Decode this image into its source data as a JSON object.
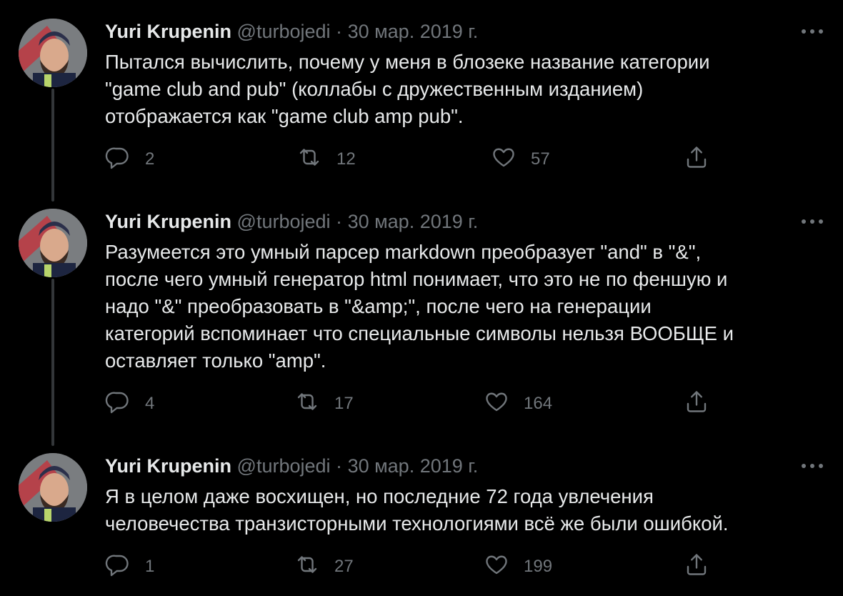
{
  "tweets": [
    {
      "name": "Yuri Krupenin",
      "handle": "@turbojedi",
      "separator": "·",
      "date": "30 мар. 2019 г.",
      "text": "Пытался вычислить, почему у меня в блозеке название категории\n\"game club and pub\" (коллабы с дружественным изданием)\nотображается как \"game club amp pub\".",
      "replies": "2",
      "retweets": "12",
      "likes": "57"
    },
    {
      "name": "Yuri Krupenin",
      "handle": "@turbojedi",
      "separator": "·",
      "date": "30 мар. 2019 г.",
      "text": "Разумеется это умный парсер markdown преобразует \"and\" в  \"&\",\nпосле чего умный генератор html понимает, что это не по феншую и\nнадо \"&\" преобразовать в \"&amp;\", после чего на генерации\nкатегорий вспоминает что специальные символы нельзя ВООБЩЕ и\nоставляет только \"amp\".",
      "replies": "4",
      "retweets": "17",
      "likes": "164"
    },
    {
      "name": "Yuri Krupenin",
      "handle": "@turbojedi",
      "separator": "·",
      "date": "30 мар. 2019 г.",
      "text": "Я в целом даже восхищен, но последние 72 года увлечения\nчеловечества транзисторными технологиями всё же были ошибкой.",
      "replies": "1",
      "retweets": "27",
      "likes": "199"
    }
  ],
  "colors": {
    "background": "#000000",
    "primary_text": "#e7e9ea",
    "secondary_text": "#71767b",
    "thread_line": "#333639"
  },
  "icons": [
    "avatar",
    "more-icon",
    "reply-icon",
    "retweet-icon",
    "like-icon",
    "share-icon"
  ]
}
